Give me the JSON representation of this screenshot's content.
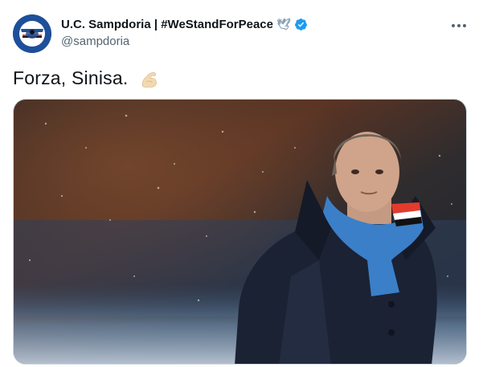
{
  "account": {
    "display_name": "U.C. Sampdoria | #WeStandForPeace",
    "dove_symbol": "🕊",
    "handle": "@sampdoria",
    "verified": true,
    "verified_color": "#1d9bf0"
  },
  "tweet": {
    "text": "Forza, Sinisa.",
    "emoji": "flexed-biceps-icon"
  },
  "icons": {
    "more": "more-options-icon",
    "avatar": "sampdoria-crest-icon"
  },
  "colors": {
    "text_primary": "#0f1419",
    "text_secondary": "#536471",
    "brand_blue": "#1e4f9a"
  }
}
